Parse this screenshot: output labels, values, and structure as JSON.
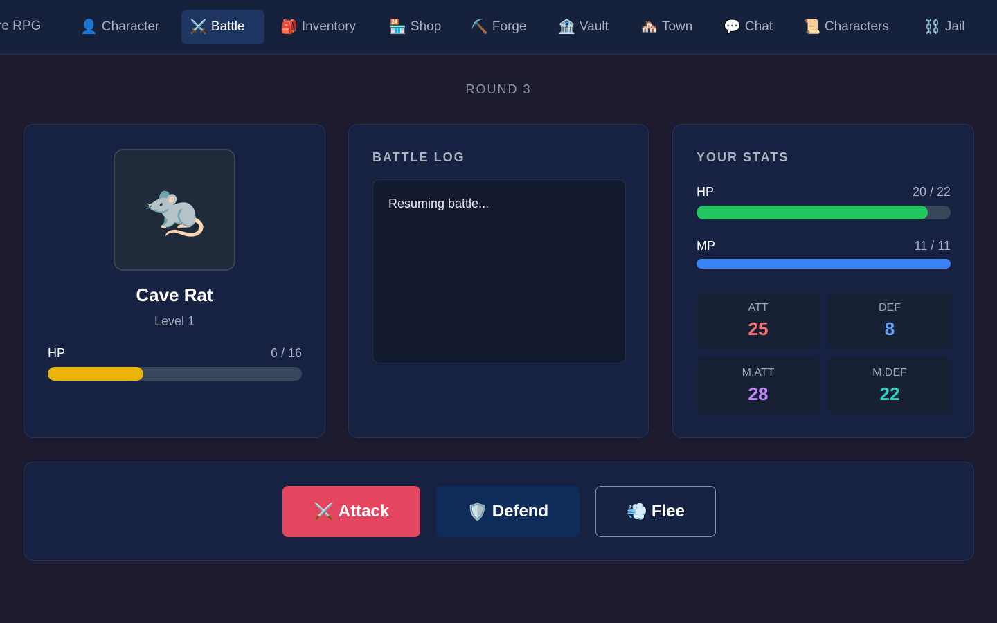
{
  "nav": {
    "brand": "re RPG",
    "items": [
      {
        "label": "Character",
        "icon": "👤",
        "active": false
      },
      {
        "label": "Battle",
        "icon": "⚔️",
        "active": true
      },
      {
        "label": "Inventory",
        "icon": "🎒",
        "active": false
      },
      {
        "label": "Shop",
        "icon": "🏪",
        "active": false
      },
      {
        "label": "Forge",
        "icon": "⛏️",
        "active": false
      },
      {
        "label": "Vault",
        "icon": "🏦",
        "active": false
      },
      {
        "label": "Town",
        "icon": "🏘️",
        "active": false
      },
      {
        "label": "Chat",
        "icon": "💬",
        "active": false
      },
      {
        "label": "Characters",
        "icon": "📜",
        "active": false
      },
      {
        "label": "Jail",
        "icon": "⛓️",
        "active": false
      }
    ]
  },
  "battle": {
    "round": "ROUND 3"
  },
  "enemy": {
    "icon": "🐀",
    "name": "Cave Rat",
    "level": "Level 1",
    "hp_label": "HP",
    "hp_text": "6 / 16",
    "hp_percent": 37.5,
    "hp_color": "#eab308"
  },
  "log": {
    "title": "BATTLE LOG",
    "lines": [
      "Resuming battle..."
    ]
  },
  "stats": {
    "title": "YOUR STATS",
    "hp_label": "HP",
    "hp_text": "20 / 22",
    "hp_percent": 90.9,
    "hp_color": "#22c55e",
    "mp_label": "MP",
    "mp_text": "11 / 11",
    "mp_percent": 100,
    "mp_color": "#3b82f6",
    "att_label": "ATT",
    "att_value": "25",
    "att_color": "#f87171",
    "def_label": "DEF",
    "def_value": "8",
    "def_color": "#60a5fa",
    "matt_label": "M.ATT",
    "matt_value": "28",
    "matt_color": "#c084fc",
    "mdef_label": "M.DEF",
    "mdef_value": "22",
    "mdef_color": "#2dd4bf"
  },
  "actions": {
    "attack_icon": "⚔️",
    "attack_label": "Attack",
    "defend_icon": "🛡️",
    "defend_label": "Defend",
    "flee_icon": "💨",
    "flee_label": "Flee"
  }
}
